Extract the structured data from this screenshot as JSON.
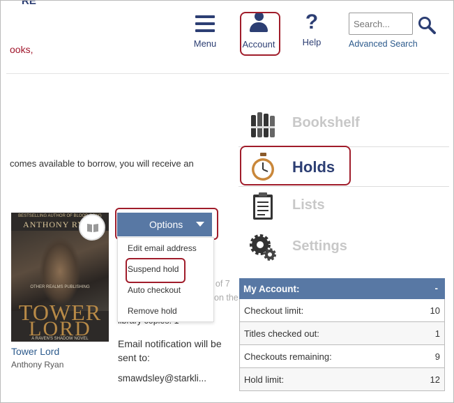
{
  "header": {
    "logo_fragment": "RE",
    "brand_fragment": "ooks,",
    "nav": {
      "menu_label": "Menu",
      "account_label": "Account",
      "help_label": "Help"
    },
    "search": {
      "placeholder": "Search...",
      "advanced_label": "Advanced Search"
    }
  },
  "main": {
    "description": "comes available to borrow, you will receive an",
    "behind_fragments": {
      "line1": "nt of 7",
      "line2": "on the waiting list",
      "line3": "library copies: 1"
    },
    "book": {
      "cover_banner": "BESTSELLING AUTHOR OF BLOOD SONG",
      "cover_author": "ANTHONY RYAN",
      "cover_publisher": "OTHER REALMS PUBLISHING",
      "cover_title_1": "TOWER",
      "cover_title_2": "LORD",
      "cover_series": "A RAVEN'S SHADOW NOVEL",
      "title": "Tower Lord",
      "author": "Anthony Ryan"
    },
    "options": {
      "button_label": "Options",
      "items": [
        "Edit email address",
        "Suspend hold",
        "Auto checkout",
        "Remove hold"
      ]
    },
    "email": {
      "label": "Email notification will be sent to:",
      "value": "smawdsley@starkli..."
    }
  },
  "sidebar": {
    "items": [
      {
        "label": "Bookshelf",
        "active": false,
        "icon": "bookshelf-icon"
      },
      {
        "label": "Holds",
        "active": true,
        "icon": "stopwatch-icon"
      },
      {
        "label": "Lists",
        "active": false,
        "icon": "clipboard-icon"
      },
      {
        "label": "Settings",
        "active": false,
        "icon": "gears-icon"
      }
    ]
  },
  "account": {
    "title": "My Account:",
    "collapse_symbol": "-",
    "rows": [
      {
        "label": "Checkout limit:",
        "value": "10"
      },
      {
        "label": "Titles checked out:",
        "value": "1"
      },
      {
        "label": "Checkouts remaining:",
        "value": "9"
      },
      {
        "label": "Hold limit:",
        "value": "12"
      }
    ]
  },
  "colors": {
    "brand_navy": "#2c3e73",
    "accent_blue": "#5878a4",
    "highlight_red": "#a01c2a",
    "link_blue": "#2c5a8c"
  }
}
